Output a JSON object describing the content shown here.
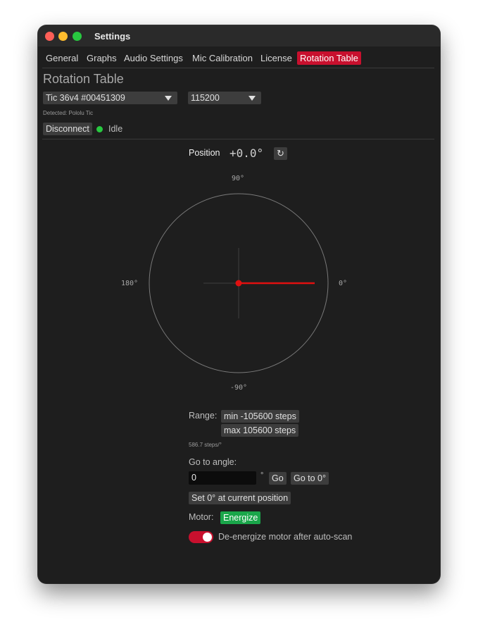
{
  "window": {
    "title": "Settings"
  },
  "tabs": [
    {
      "label": "General"
    },
    {
      "label": "Graphs"
    },
    {
      "label": "Audio Settings"
    },
    {
      "label": "Mic Calibration"
    },
    {
      "label": "License"
    },
    {
      "label": "Rotation Table",
      "active": true
    }
  ],
  "page_title": "Rotation Table",
  "device": {
    "selected": "Tic 36v4 #00451309",
    "baud": "115200",
    "detected": "Detected: Pololu Tic",
    "disconnect_label": "Disconnect",
    "status": "Idle",
    "status_color": "#28c840"
  },
  "position": {
    "label": "Position",
    "value": "+0.0°",
    "refresh_icon": "refresh-icon"
  },
  "dial": {
    "label_top": "90°",
    "label_left": "180°",
    "label_right": "0°",
    "label_bottom": "-90°",
    "angle_deg": 0,
    "needle_color": "#e01010"
  },
  "range": {
    "label": "Range:",
    "min_label": "min -105600 steps",
    "max_label": "max 105600 steps",
    "steps_per_degree": "586.7 steps/°"
  },
  "goto": {
    "label": "Go to angle:",
    "value": "0",
    "unit": "°",
    "go_label": "Go",
    "go_zero_label": "Go to 0°",
    "set_zero_label": "Set 0° at current position"
  },
  "motor": {
    "label": "Motor:",
    "energize_label": "Energize",
    "deenergize_label": "De-energize motor after auto-scan",
    "deenergize_on": true
  },
  "colors": {
    "accent": "#c8102e",
    "energize": "#1aa64a",
    "background": "#1e1e1e"
  }
}
